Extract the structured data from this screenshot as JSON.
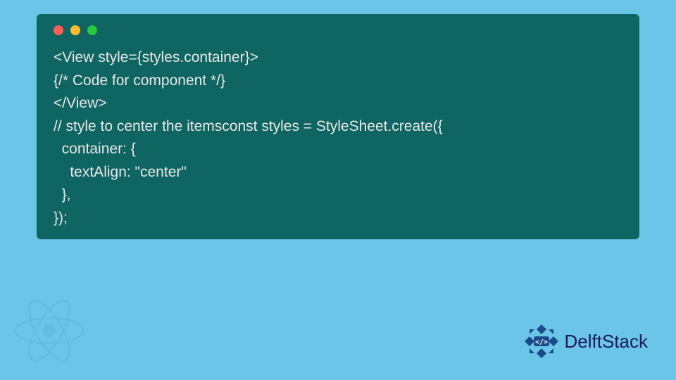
{
  "code": {
    "lines": [
      "<View style={styles.container}>",
      "{/* Code for component */}",
      "</View>",
      "// style to center the itemsconst styles = StyleSheet.create({",
      "  container: {",
      "    textAlign: \"center\"",
      "  },",
      "});"
    ]
  },
  "brand": {
    "name_part1": "Delft",
    "name_part2": "Stack"
  },
  "colors": {
    "page_bg": "#6bc5e8",
    "code_bg": "#0f6562",
    "code_text": "#e8e8e8",
    "brand_accent": "#1a4a8a"
  }
}
